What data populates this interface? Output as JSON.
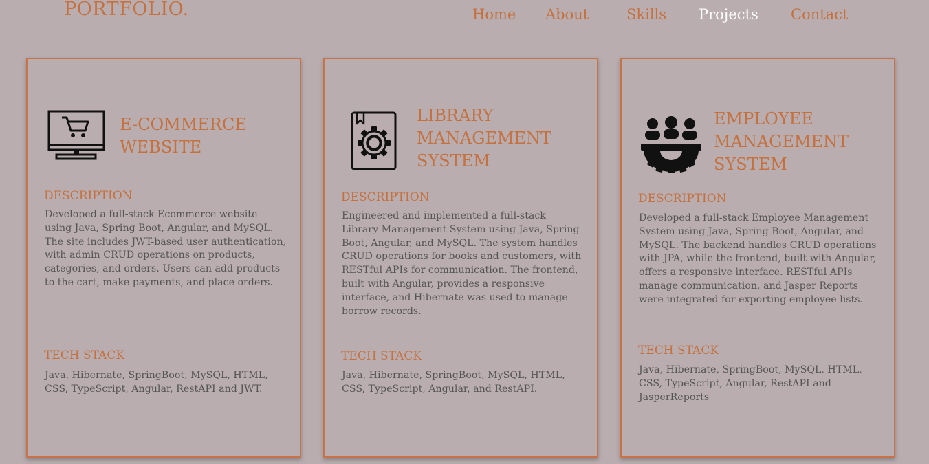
{
  "header": {
    "logo": "PORTFOLIO.",
    "nav": [
      {
        "label": "Home"
      },
      {
        "label": "About"
      },
      {
        "label": "Skills"
      },
      {
        "label": "Projects",
        "active": true
      },
      {
        "label": "Contact"
      }
    ]
  },
  "projects": [
    {
      "icon": "monitor-cart-icon",
      "title_lines": [
        "E-COMMERCE",
        "WEBSITE"
      ],
      "description_label": "DESCRIPTION",
      "description": "Developed a full-stack Ecommerce website using Java, Spring Boot, Angular, and MySQL. The site includes JWT-based user authentication, with admin CRUD operations on products, categories, and orders. Users can add products to the cart, make payments, and place orders.",
      "tech_label": "TECH STACK",
      "tech": "Java, Hibernate, SpringBoot, MySQL, HTML, CSS, TypeScript, Angular, RestAPI and JWT."
    },
    {
      "icon": "book-gear-icon",
      "title_lines": [
        "LIBRARY",
        "MANAGEMENT",
        "SYSTEM"
      ],
      "description_label": "DESCRIPTION",
      "description": "Engineered and implemented a full-stack Library Management System using Java, Spring Boot, Angular, and MySQL. The system handles CRUD operations for books and customers, with RESTful APIs for communication. The frontend, built with Angular, provides a responsive interface, and Hibernate was used to manage borrow records.",
      "tech_label": "TECH STACK",
      "tech": "Java, Hibernate, SpringBoot, MySQL, HTML, CSS, TypeScript, Angular, and RestAPI."
    },
    {
      "icon": "team-gear-icon",
      "title_lines": [
        "EMPLOYEE",
        "MANAGEMENT",
        "SYSTEM"
      ],
      "description_label": "DESCRIPTION",
      "description": "Developed a full-stack Employee Management System using Java, Spring Boot, Angular, and MySQL. The backend handles CRUD operations with JPA, while the frontend, built with Angular, offers a responsive interface. RESTful APIs manage communication, and Jasper Reports were integrated for exporting employee lists.",
      "tech_label": "TECH STACK",
      "tech": "Java, Hibernate, SpringBoot, MySQL, HTML, CSS, TypeScript, Angular, RestAPI and JasperReports"
    }
  ],
  "colors": {
    "background": "#b9adb0",
    "accent": "#c4713f",
    "border": "#c67347",
    "body_text": "#555555",
    "active_nav": "#ffffff"
  }
}
